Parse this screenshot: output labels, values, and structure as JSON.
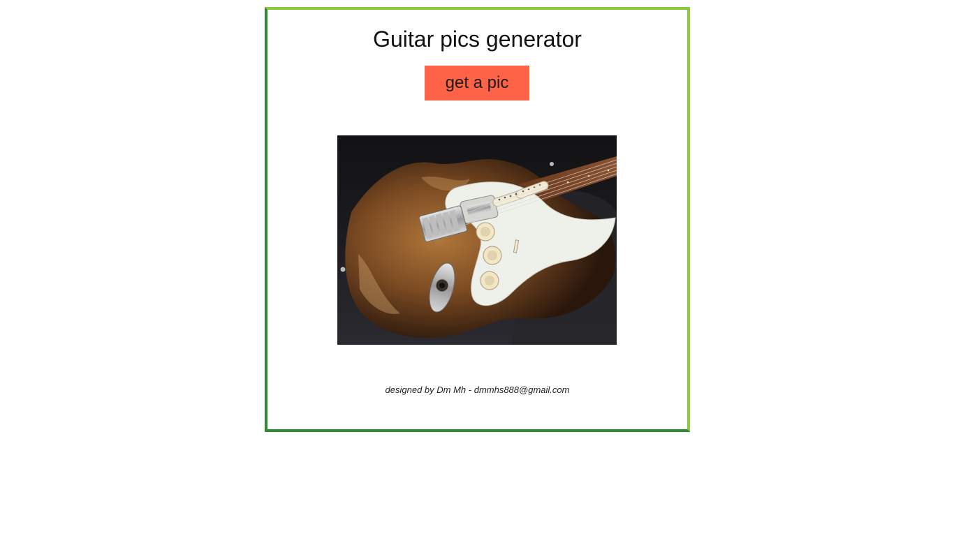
{
  "page": {
    "title": "Guitar pics generator",
    "button_label": "get a pic",
    "credit": "designed by Dm Mh - dmmhs888@gmail.com"
  },
  "image": {
    "subject": "electric guitar photo"
  },
  "colors": {
    "button_bg": "#ff6347",
    "frame_dark_green": "#2e8b2e",
    "frame_light_green": "#8dc63f"
  }
}
